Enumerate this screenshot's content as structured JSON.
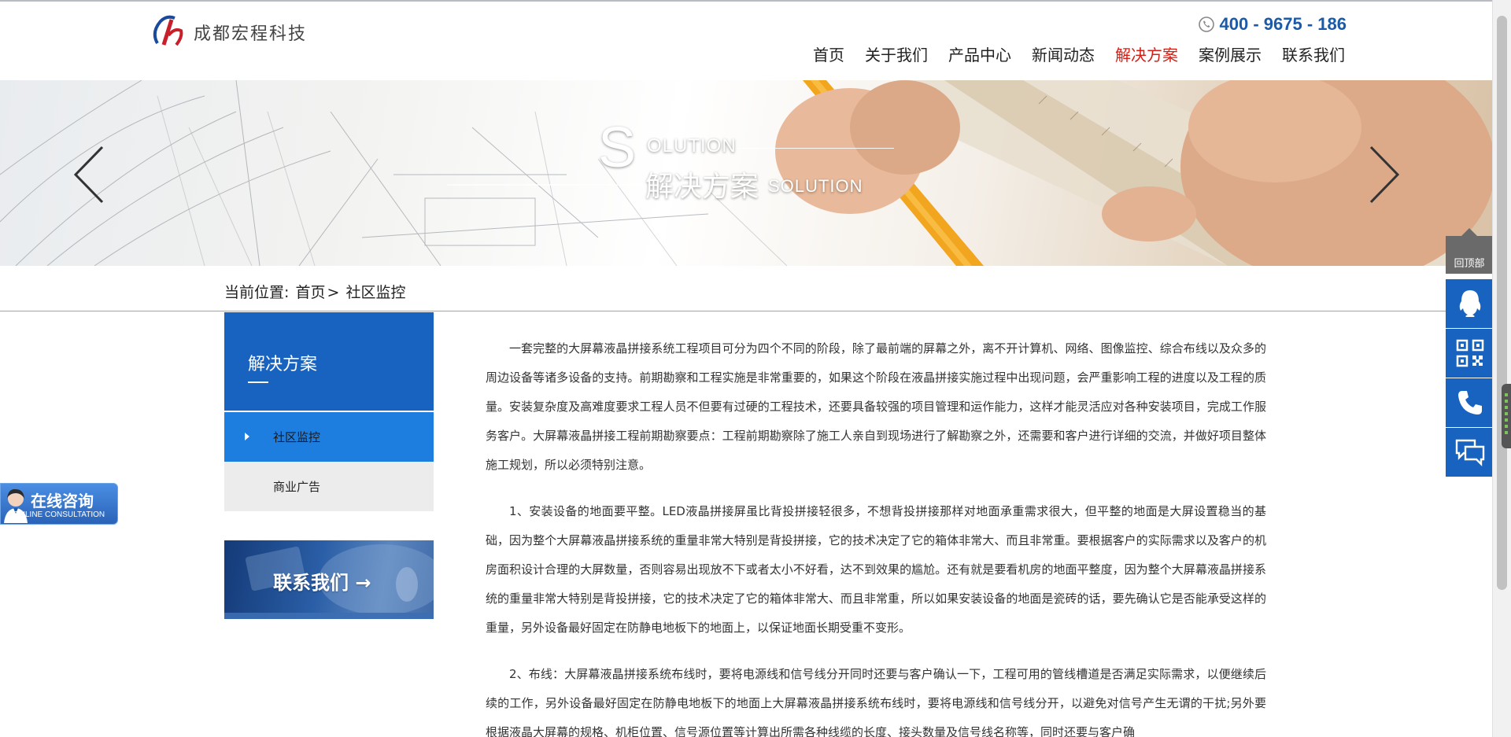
{
  "header": {
    "logo_text": "成都宏程科技",
    "hotline": "400 - 9675 - 186",
    "nav": [
      {
        "label": "首页",
        "active": false
      },
      {
        "label": "关于我们",
        "active": false
      },
      {
        "label": "产品中心",
        "active": false
      },
      {
        "label": "新闻动态",
        "active": false
      },
      {
        "label": "解决方案",
        "active": true
      },
      {
        "label": "案例展示",
        "active": false
      },
      {
        "label": "联系我们",
        "active": false
      }
    ],
    "active_color": "#d41e14"
  },
  "banner": {
    "big_letter": "S",
    "eng_top": "OLUTION",
    "title_cn": "解决方案",
    "eng_bottom": "SOLUTION"
  },
  "breadcrumb": {
    "prefix": "当前位置:",
    "home": "首页",
    "separator": ">",
    "current": "社区监控"
  },
  "sidebar": {
    "title": "解决方案",
    "items": [
      {
        "label": "社区监控",
        "active": true
      },
      {
        "label": "商业广告",
        "active": false
      }
    ],
    "contact_label": "联系我们  →"
  },
  "article": {
    "paragraphs": [
      "一套完整的大屏幕液晶拼接系统工程项目可分为四个不同的阶段，除了最前端的屏幕之外，离不开计算机、网络、图像监控、综合布线以及众多的周边设备等诸多设备的支持。前期勘察和工程实施是非常重要的，如果这个阶段在液晶拼接实施过程中出现问题，会严重影响工程的进度以及工程的质量。安装复杂度及高难度要求工程人员不但要有过硬的工程技术，还要具备较强的项目管理和运作能力，这样才能灵活应对各种安装项目，完成工作服务客户。大屏幕液晶拼接工程前期勘察要点：工程前期勘察除了施工人亲自到现场进行了解勘察之外，还需要和客户进行详细的交流，并做好项目整体施工规划，所以必须特别注意。",
      "1、安装设备的地面要平整。LED液晶拼接屏虽比背投拼接轻很多，不想背投拼接那样对地面承重需求很大，但平整的地面是大屏设置稳当的基础，因为整个大屏幕液晶拼接系统的重量非常大特别是背投拼接，它的技术决定了它的箱体非常大、而且非常重。要根据客户的实际需求以及客户的机房面积设计合理的大屏数量，否则容易出现放不下或者太小不好看，达不到效果的尴尬。还有就是要看机房的地面平整度，因为整个大屏幕液晶拼接系统的重量非常大特别是背投拼接，它的技术决定了它的箱体非常大、而且非常重，所以如果安装设备的地面是瓷砖的话，要先确认它是否能承受这样的重量，另外设备最好固定在防静电地板下的地面上，以保证地面长期受重不变形。",
      "2、布线：大屏幕液晶拼接系统布线时，要将电源线和信号线分开同时还要与客户确认一下，工程可用的管线槽道是否满足实际需求，以便继续后续的工作，另外设备最好固定在防静电地板下的地面上大屏幕液晶拼接系统布线时，要将电源线和信号线分开，以避免对信号产生无谓的干扰;另外要根据液晶大屏幕的规格、机柜位置、信号源位置等计算出所需各种线缆的长度、接头数量及信号线名称等，同时还要与客户确"
    ]
  },
  "floating": {
    "online_cn": "在线咨询",
    "online_en": "ONLINE CONSULTATION",
    "to_top": "回顶部",
    "tools": [
      "qq-icon",
      "qrcode-icon",
      "phone-icon",
      "message-icon"
    ]
  },
  "colors": {
    "brand_blue": "#1863c0",
    "nav_active": "#d41e14",
    "hotline": "#1a5aa8"
  }
}
